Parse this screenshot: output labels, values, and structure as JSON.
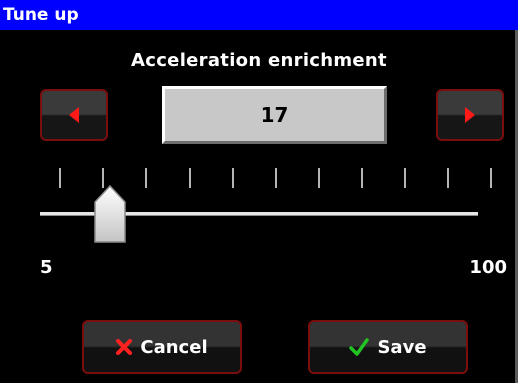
{
  "window": {
    "title": "Tune up"
  },
  "setting": {
    "name": "Acceleration enrichment",
    "value": "17",
    "min_label": "5",
    "max_label": "100"
  },
  "slider": {
    "min": 5,
    "max": 100,
    "value": 17,
    "tick_count": 12
  },
  "icons": {
    "decrease": "left-triangle-icon",
    "increase": "right-triangle-icon",
    "cancel": "x-mark-icon",
    "save": "checkmark-icon"
  },
  "buttons": {
    "cancel_label": "Cancel",
    "save_label": "Save"
  },
  "colors": {
    "title_bar": "#0000ff",
    "background": "#000000",
    "button_border": "#7a0d0d",
    "arrow": "#ff1a1a",
    "cancel_icon": "#ff2020",
    "save_icon": "#22c422",
    "value_box": "#c8c8c8"
  }
}
